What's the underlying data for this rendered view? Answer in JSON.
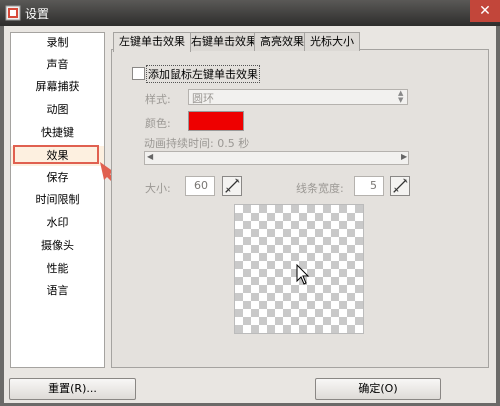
{
  "window": {
    "title": "设置",
    "close_symbol": "✕"
  },
  "sidebar": {
    "items": [
      {
        "label": "录制"
      },
      {
        "label": "声音"
      },
      {
        "label": "屏幕捕获"
      },
      {
        "label": "动图"
      },
      {
        "label": "快捷键"
      },
      {
        "label": "效果"
      },
      {
        "label": "保存"
      },
      {
        "label": "时间限制"
      },
      {
        "label": "水印"
      },
      {
        "label": "摄像头"
      },
      {
        "label": "性能"
      },
      {
        "label": "语言"
      }
    ],
    "selected_index": 5
  },
  "tabs": [
    {
      "label": "左键单击效果"
    },
    {
      "label": "右键单击效果"
    },
    {
      "label": "高亮效果"
    },
    {
      "label": "光标大小"
    }
  ],
  "left_click": {
    "enable_label": "添加鼠标左键单击效果",
    "enabled": false,
    "style_label": "样式:",
    "style_value": "圆环",
    "color_label": "颜色:",
    "color_value": "#ee0000",
    "duration_label": "动画持续时间: 0.5 秒",
    "size_label": "大小:",
    "size_value": "60",
    "line_width_label": "线条宽度:",
    "line_width_value": "5"
  },
  "buttons": {
    "reset": "重置(R)...",
    "ok": "确定(O)"
  },
  "colors": {
    "titlebar": "#3a3938",
    "annotation_red": "#e06050"
  }
}
